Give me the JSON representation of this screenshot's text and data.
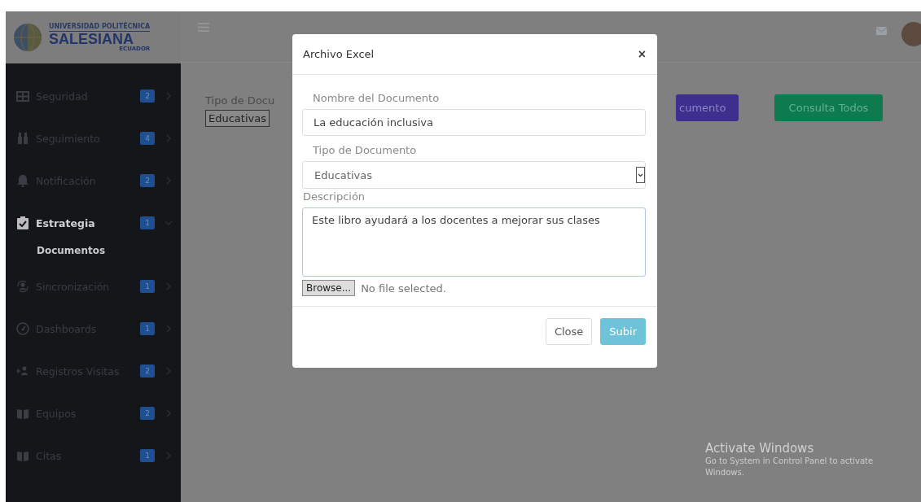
{
  "logo": {
    "top_line": "UNIVERSIDAD POLITÉCNICA",
    "name": "SALESIANA",
    "country": "ECUADOR"
  },
  "sidebar": {
    "items": [
      {
        "label": "Seguridad",
        "badge": "2",
        "expanded": false
      },
      {
        "label": "Seguimiento",
        "badge": "4",
        "expanded": false
      },
      {
        "label": "Notificación",
        "badge": "2",
        "expanded": false
      },
      {
        "label": "Estrategia",
        "badge": "1",
        "expanded": true,
        "children": [
          {
            "label": "Documentos"
          }
        ]
      },
      {
        "label": "Sincronización",
        "badge": "1",
        "expanded": false
      },
      {
        "label": "Dashboards",
        "badge": "1",
        "expanded": false
      },
      {
        "label": "Registros Visitas",
        "badge": "2",
        "expanded": false
      },
      {
        "label": "Equipos",
        "badge": "2",
        "expanded": false
      },
      {
        "label": "Citas",
        "badge": "1",
        "expanded": false
      }
    ]
  },
  "page": {
    "filter_label": "Tipo de Docu",
    "filter_value": "Educativas",
    "buttons": [
      {
        "label": "cumento",
        "kind": "primary"
      },
      {
        "label": "Consulta Todos",
        "kind": "success"
      }
    ]
  },
  "modal": {
    "title": "Archivo Excel",
    "close": "×",
    "fields": [
      {
        "kind": "text",
        "label": "Nombre del Documento",
        "value": "La educación inclusiva"
      },
      {
        "kind": "select",
        "label": "Tipo de Documento",
        "value": "Educativas"
      },
      {
        "kind": "textarea",
        "label": "Descripción",
        "value": "Este libro ayudará a los docentes a mejorar sus clases"
      }
    ],
    "file": {
      "button": "Browse...",
      "status": "No file selected."
    },
    "buttons": [
      {
        "label": "Close",
        "kind": "default"
      },
      {
        "label": "Subir",
        "kind": "info"
      }
    ]
  },
  "os_notice": {
    "title": "Activate Windows",
    "message": "Go to System in Control Panel to activate Windows."
  }
}
